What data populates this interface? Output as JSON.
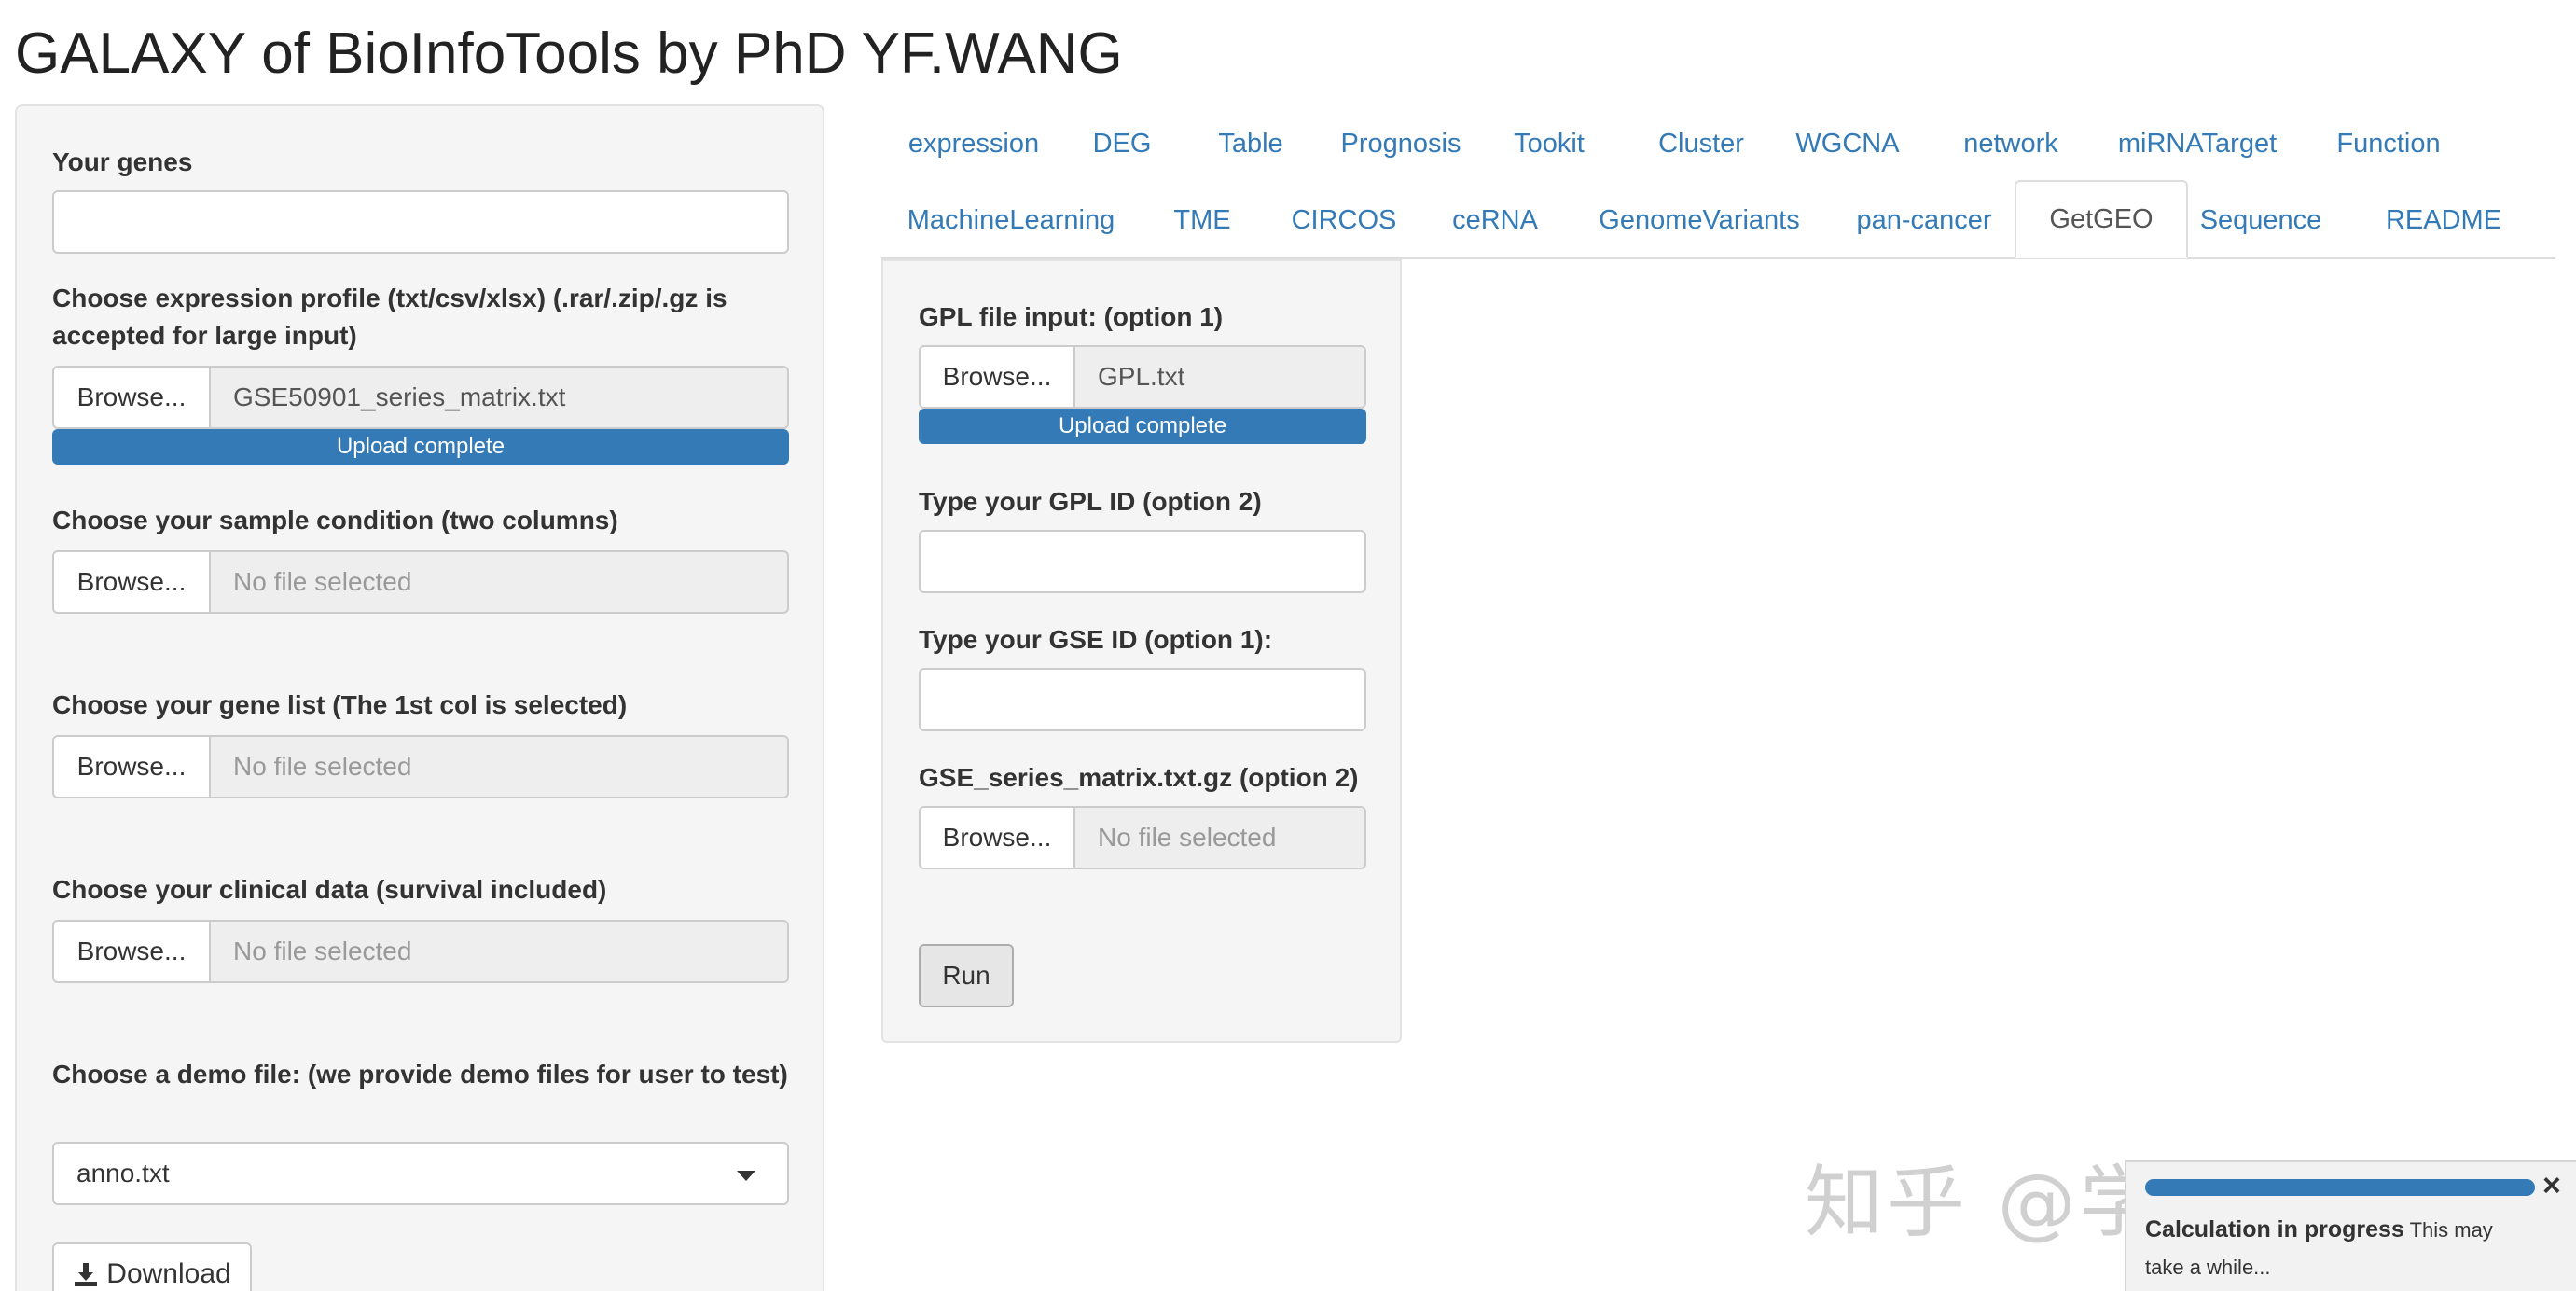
{
  "app": {
    "title": "GALAXY of BioInfoTools by PhD YF.WANG"
  },
  "sidebar": {
    "genes_label": "Your genes",
    "expr_label": "Choose expression profile (txt/csv/xlsx) (.rar/.zip/.gz is accepted for large input)",
    "expr_file": "GSE50901_series_matrix.txt",
    "expr_progress": "Upload complete",
    "condition_label": "Choose your sample condition (two columns)",
    "condition_file": "No file selected",
    "genelist_label": "Choose your gene list (The 1st col is selected)",
    "genelist_file": "No file selected",
    "clinical_label": "Choose your clinical data (survival included)",
    "clinical_file": "No file selected",
    "demo_label": "Choose a demo file: (we provide demo files for user to test)",
    "demo_selected": "anno.txt",
    "browse_label": "Browse...",
    "download_label": "Download"
  },
  "tabs": {
    "row1": [
      "expression",
      "DEG",
      "Table",
      "Prognosis",
      "Tookit",
      "Cluster",
      "WGCNA",
      "network",
      "miRNATarget",
      "Function"
    ],
    "row2": [
      "MachineLearning",
      "TME",
      "CIRCOS",
      "ceRNA",
      "GenomeVariants",
      "pan-cancer",
      "GetGEO",
      "Sequence",
      "README"
    ],
    "active": "GetGEO"
  },
  "geo": {
    "gpl_file_label": "GPL file input: (option 1)",
    "gpl_file": "GPL.txt",
    "gpl_progress": "Upload complete",
    "gpl_id_label": "Type your GPL ID (option 2)",
    "gse_id_label": "Type your GSE ID (option 1):",
    "gse_matrix_label": "GSE_series_matrix.txt.gz (option 2)",
    "gse_matrix_file": "No file selected",
    "browse_label": "Browse...",
    "run_label": "Run"
  },
  "notification": {
    "title": "Calculation in progress",
    "message": "This may take a while...",
    "close": "×"
  },
  "watermark": "知乎 @学术渣在欧洲",
  "colors": {
    "accent": "#337ab7",
    "panel_bg": "#f5f5f5",
    "link": "#337ab7"
  }
}
